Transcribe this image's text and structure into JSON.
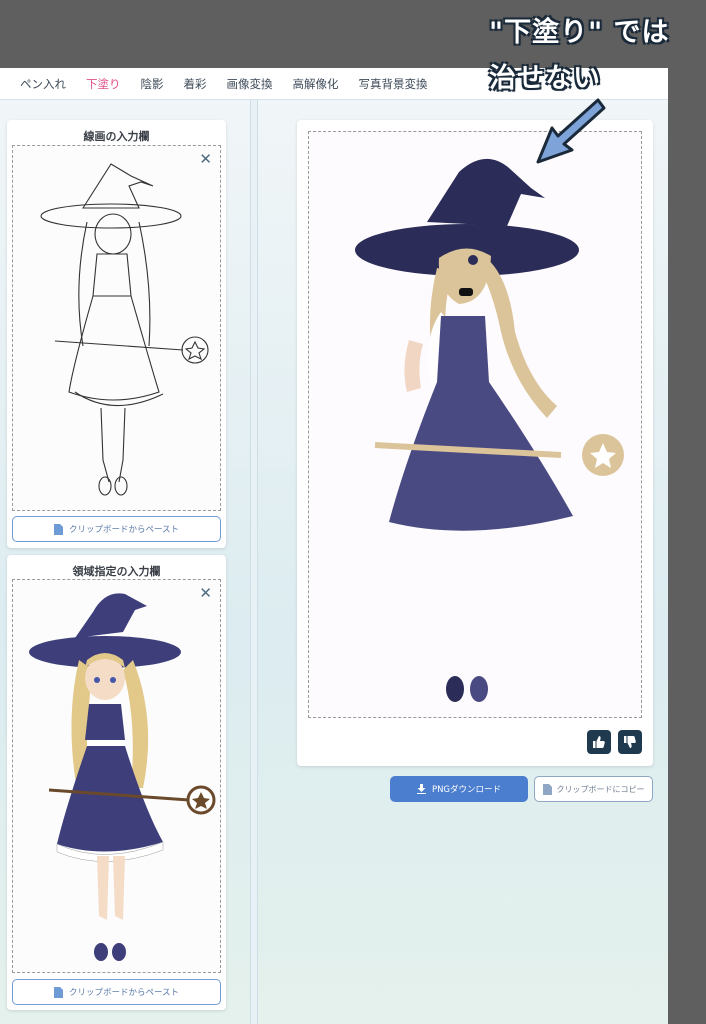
{
  "tabs": [
    {
      "label": "ペン入れ",
      "active": false
    },
    {
      "label": "下塗り",
      "active": true
    },
    {
      "label": "陰影",
      "active": false
    },
    {
      "label": "着彩",
      "active": false
    },
    {
      "label": "画像変換",
      "active": false
    },
    {
      "label": "高解像化",
      "active": false
    },
    {
      "label": "写真背景変換",
      "active": false
    }
  ],
  "lineart_panel": {
    "title": "線画の入力欄",
    "paste_label": "クリップボードからペースト"
  },
  "region_panel": {
    "title": "領域指定の入力欄",
    "paste_label": "クリップボードからペースト"
  },
  "result_panel": {
    "download_label": "PNGダウンロード",
    "copy_label": "クリップボードにコピー"
  },
  "annotation": {
    "line1": "\"下塗り\" では",
    "line2": "治せない",
    "arrow_color": "#7ea3d8"
  },
  "colors": {
    "active_tab": "#e0508a",
    "primary_button": "#4b7ecf",
    "feedback_button": "#1f3a4f",
    "hat_navy": "#2c2c58",
    "dress_indigo": "#4a4a82",
    "hair_beige": "#dcc49a"
  }
}
